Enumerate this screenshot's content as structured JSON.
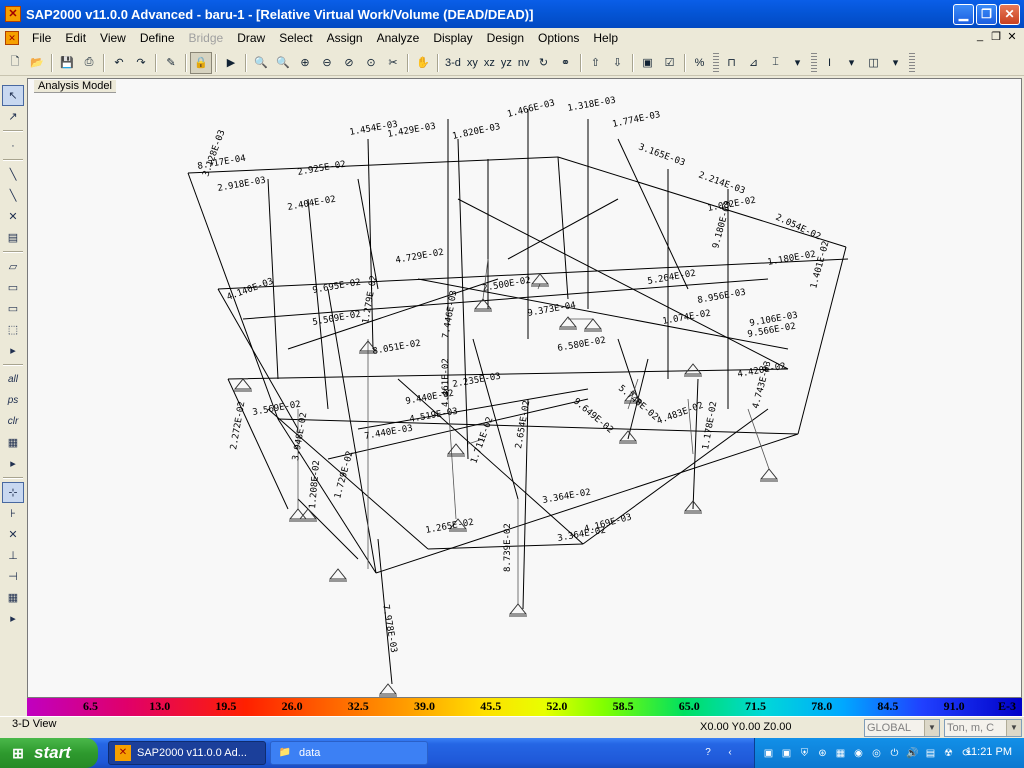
{
  "window": {
    "title": "SAP2000 v11.0.0 Advanced  - baru-1 - [Relative Virtual Work/Volume (DEAD/DEAD)]",
    "app_icon": "sap2000-icon"
  },
  "menu": {
    "items": [
      "File",
      "Edit",
      "View",
      "Define",
      "Bridge",
      "Draw",
      "Select",
      "Assign",
      "Analyze",
      "Display",
      "Design",
      "Options",
      "Help"
    ],
    "disabled": [
      "Bridge"
    ]
  },
  "toolbar": {
    "view_buttons": [
      "3-d",
      "xy",
      "xz",
      "yz",
      "nv"
    ]
  },
  "viewport": {
    "label": "Analysis Model",
    "values": [
      "8.717E-04",
      "2.918E-03",
      "2.925E-02",
      "1.454E-03",
      "1.429E-03",
      "1.820E-03",
      "1.466E-03",
      "1.318E-03",
      "1.774E-03",
      "3.165E-03",
      "2.214E-03",
      "2.054E-02",
      "1.180E-02",
      "1.401E-02",
      "2.404E-02",
      "9.695E-02",
      "4.729E-02",
      "5.509E-02",
      "9.373E-04",
      "6.580E-02",
      "4.140E-03",
      "3.569E-02",
      "7.446E-03",
      "4.519E-03",
      "2.235E-03",
      "1.711E-02",
      "2.654E-02",
      "9.649E-02",
      "5.748E-02",
      "4.483E-02",
      "1.178E-02",
      "4.420E-02",
      "9.566E-02",
      "4.743E-03",
      "1.729E-02",
      "1.208E-02",
      "3.364E-02",
      "4.169E-03",
      "1.265E-02",
      "3.364E-02",
      "8.739E-02",
      "7.978E-03",
      "4.461E-02",
      "2.272E-02",
      "3.948E-02",
      "7.440E-03",
      "9.440E-02",
      "2.500E-02",
      "8.051E-02",
      "1.279E-02",
      "5.264E-02",
      "1.074E-02",
      "9.180E-03",
      "9.106E-03",
      "8.956E-03",
      "1.082E-02",
      "3.128E-03"
    ]
  },
  "color_scale": {
    "labels": [
      "6.5",
      "13.0",
      "19.5",
      "26.0",
      "32.5",
      "39.0",
      "45.5",
      "52.0",
      "58.5",
      "65.0",
      "71.5",
      "78.0",
      "84.5",
      "91.0",
      "E-3"
    ]
  },
  "status": {
    "view_name": "3-D View",
    "coords": "X0.00  Y0.00  Z0.00",
    "coord_system": "GLOBAL",
    "units": "Ton, m, C"
  },
  "taskbar": {
    "start_label": "start",
    "tasks": [
      {
        "label": "SAP2000 v11.0.0 Ad..."
      },
      {
        "label": "data"
      }
    ],
    "clock": "11:21 PM"
  }
}
